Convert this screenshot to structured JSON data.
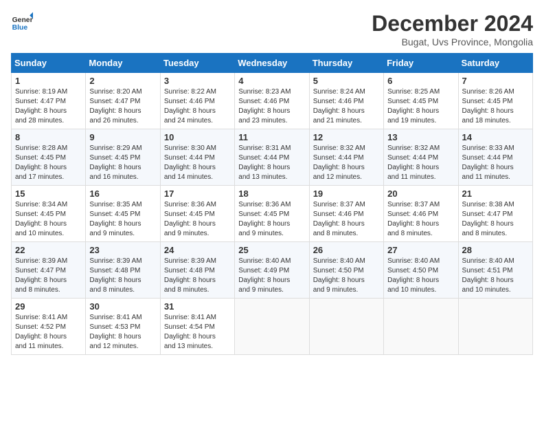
{
  "header": {
    "logo_line1": "General",
    "logo_line2": "Blue",
    "month": "December 2024",
    "location": "Bugat, Uvs Province, Mongolia"
  },
  "weekdays": [
    "Sunday",
    "Monday",
    "Tuesday",
    "Wednesday",
    "Thursday",
    "Friday",
    "Saturday"
  ],
  "weeks": [
    [
      {
        "day": "1",
        "info": "Sunrise: 8:19 AM\nSunset: 4:47 PM\nDaylight: 8 hours\nand 28 minutes."
      },
      {
        "day": "2",
        "info": "Sunrise: 8:20 AM\nSunset: 4:47 PM\nDaylight: 8 hours\nand 26 minutes."
      },
      {
        "day": "3",
        "info": "Sunrise: 8:22 AM\nSunset: 4:46 PM\nDaylight: 8 hours\nand 24 minutes."
      },
      {
        "day": "4",
        "info": "Sunrise: 8:23 AM\nSunset: 4:46 PM\nDaylight: 8 hours\nand 23 minutes."
      },
      {
        "day": "5",
        "info": "Sunrise: 8:24 AM\nSunset: 4:46 PM\nDaylight: 8 hours\nand 21 minutes."
      },
      {
        "day": "6",
        "info": "Sunrise: 8:25 AM\nSunset: 4:45 PM\nDaylight: 8 hours\nand 19 minutes."
      },
      {
        "day": "7",
        "info": "Sunrise: 8:26 AM\nSunset: 4:45 PM\nDaylight: 8 hours\nand 18 minutes."
      }
    ],
    [
      {
        "day": "8",
        "info": "Sunrise: 8:28 AM\nSunset: 4:45 PM\nDaylight: 8 hours\nand 17 minutes."
      },
      {
        "day": "9",
        "info": "Sunrise: 8:29 AM\nSunset: 4:45 PM\nDaylight: 8 hours\nand 16 minutes."
      },
      {
        "day": "10",
        "info": "Sunrise: 8:30 AM\nSunset: 4:44 PM\nDaylight: 8 hours\nand 14 minutes."
      },
      {
        "day": "11",
        "info": "Sunrise: 8:31 AM\nSunset: 4:44 PM\nDaylight: 8 hours\nand 13 minutes."
      },
      {
        "day": "12",
        "info": "Sunrise: 8:32 AM\nSunset: 4:44 PM\nDaylight: 8 hours\nand 12 minutes."
      },
      {
        "day": "13",
        "info": "Sunrise: 8:32 AM\nSunset: 4:44 PM\nDaylight: 8 hours\nand 11 minutes."
      },
      {
        "day": "14",
        "info": "Sunrise: 8:33 AM\nSunset: 4:44 PM\nDaylight: 8 hours\nand 11 minutes."
      }
    ],
    [
      {
        "day": "15",
        "info": "Sunrise: 8:34 AM\nSunset: 4:45 PM\nDaylight: 8 hours\nand 10 minutes."
      },
      {
        "day": "16",
        "info": "Sunrise: 8:35 AM\nSunset: 4:45 PM\nDaylight: 8 hours\nand 9 minutes."
      },
      {
        "day": "17",
        "info": "Sunrise: 8:36 AM\nSunset: 4:45 PM\nDaylight: 8 hours\nand 9 minutes."
      },
      {
        "day": "18",
        "info": "Sunrise: 8:36 AM\nSunset: 4:45 PM\nDaylight: 8 hours\nand 9 minutes."
      },
      {
        "day": "19",
        "info": "Sunrise: 8:37 AM\nSunset: 4:46 PM\nDaylight: 8 hours\nand 8 minutes."
      },
      {
        "day": "20",
        "info": "Sunrise: 8:37 AM\nSunset: 4:46 PM\nDaylight: 8 hours\nand 8 minutes."
      },
      {
        "day": "21",
        "info": "Sunrise: 8:38 AM\nSunset: 4:47 PM\nDaylight: 8 hours\nand 8 minutes."
      }
    ],
    [
      {
        "day": "22",
        "info": "Sunrise: 8:39 AM\nSunset: 4:47 PM\nDaylight: 8 hours\nand 8 minutes."
      },
      {
        "day": "23",
        "info": "Sunrise: 8:39 AM\nSunset: 4:48 PM\nDaylight: 8 hours\nand 8 minutes."
      },
      {
        "day": "24",
        "info": "Sunrise: 8:39 AM\nSunset: 4:48 PM\nDaylight: 8 hours\nand 8 minutes."
      },
      {
        "day": "25",
        "info": "Sunrise: 8:40 AM\nSunset: 4:49 PM\nDaylight: 8 hours\nand 9 minutes."
      },
      {
        "day": "26",
        "info": "Sunrise: 8:40 AM\nSunset: 4:50 PM\nDaylight: 8 hours\nand 9 minutes."
      },
      {
        "day": "27",
        "info": "Sunrise: 8:40 AM\nSunset: 4:50 PM\nDaylight: 8 hours\nand 10 minutes."
      },
      {
        "day": "28",
        "info": "Sunrise: 8:40 AM\nSunset: 4:51 PM\nDaylight: 8 hours\nand 10 minutes."
      }
    ],
    [
      {
        "day": "29",
        "info": "Sunrise: 8:41 AM\nSunset: 4:52 PM\nDaylight: 8 hours\nand 11 minutes."
      },
      {
        "day": "30",
        "info": "Sunrise: 8:41 AM\nSunset: 4:53 PM\nDaylight: 8 hours\nand 12 minutes."
      },
      {
        "day": "31",
        "info": "Sunrise: 8:41 AM\nSunset: 4:54 PM\nDaylight: 8 hours\nand 13 minutes."
      },
      null,
      null,
      null,
      null
    ]
  ]
}
